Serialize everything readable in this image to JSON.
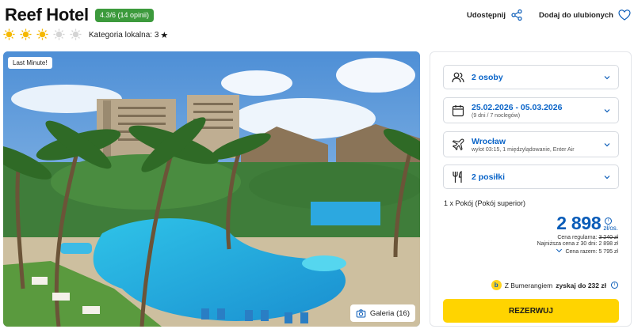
{
  "hotel": {
    "name": "Reef Hotel",
    "rating_badge": "4.3/6 (14 opinii)",
    "sun_rating": 3,
    "sun_total": 5,
    "category_label": "Kategoria lokalna: 3",
    "category_star": "★"
  },
  "actions": {
    "share": "Udostępnij",
    "favorite": "Dodaj do ulubionych"
  },
  "photo": {
    "badge": "Last Minute!",
    "gallery": "Galeria (16)"
  },
  "booking": {
    "persons": "2 osoby",
    "dates": "25.02.2026 - 05.03.2026",
    "dates_sub": "(9 dni / 7 noclegów)",
    "departure": "Wrocław",
    "departure_sub": "wylot 03:15, 1 międzylądowanie, Enter Air",
    "meals": "2 posiłki",
    "room": "1 x Pokój  (Pokój superior)",
    "price": "2 898",
    "price_unit": "zł/os.",
    "regular_label": "Cena regularna:",
    "regular_value": "3 240 zł",
    "lowest_label": "Najniższa cena z 30 dni:",
    "lowest_value": "2 898 zł",
    "total_label": "Cena razem:",
    "total_value": "5 795 zł",
    "bumerang_prefix": "Z Bumerangiem",
    "bumerang_strong": "zyskaj do 232 zł",
    "reserve": "REZERWUJ"
  },
  "colors": {
    "accent_blue": "#0a5cb8",
    "badge_green": "#3c9a3c",
    "reserve_yellow": "#ffd400"
  }
}
